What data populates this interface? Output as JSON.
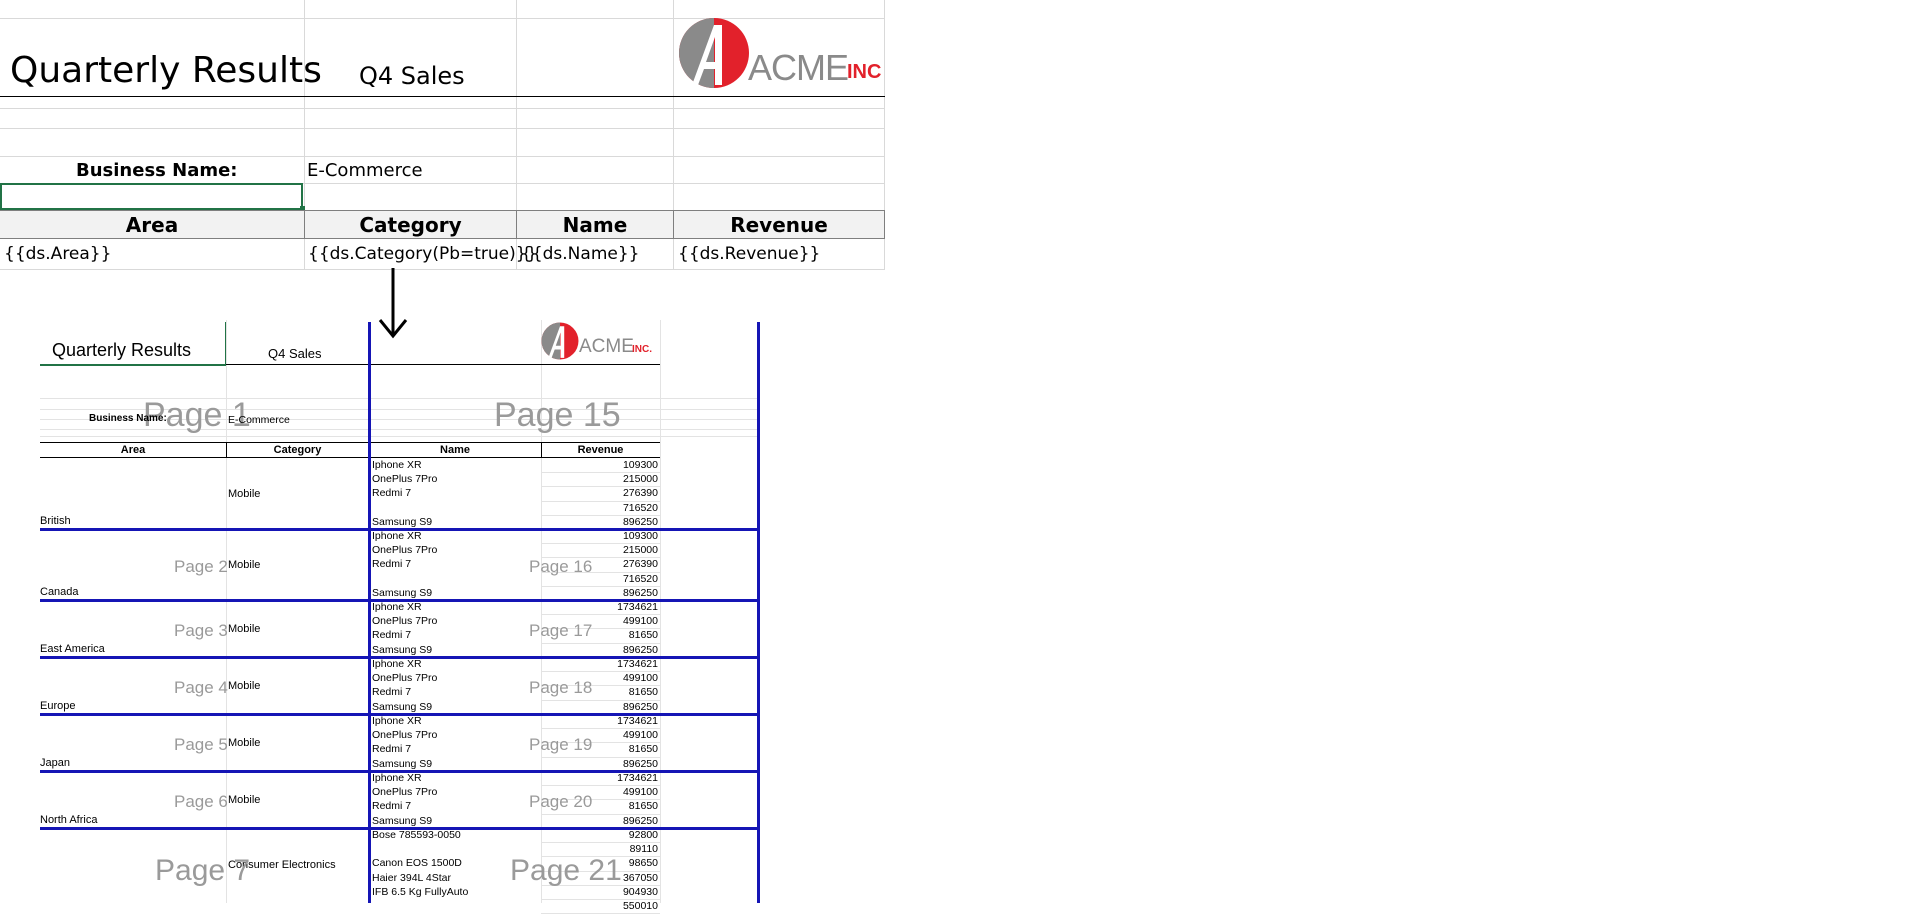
{
  "template": {
    "title": "Quarterly Results",
    "subtitle": "Q4 Sales",
    "business_label": "Business Name:",
    "business_value": "E-Commerce",
    "headers": [
      "Area",
      "Category",
      "Name",
      "Revenue"
    ],
    "placeholders": [
      "{{ds.Area}}",
      "{{ds.Category(Pb=true)}}",
      "{{ds.Name}}",
      "{{ds.Revenue}}"
    ],
    "logo": {
      "acme": "ACME",
      "inc": "INC",
      "mark": "A"
    }
  },
  "preview": {
    "title": "Quarterly Results",
    "subtitle": "Q4 Sales",
    "business_label": "Business Name:",
    "business_value": "E-Commerce",
    "headers": [
      "Area",
      "Category",
      "Name",
      "Revenue"
    ],
    "logo": {
      "acme": "ACME",
      "inc": "INC.",
      "mark": "A"
    },
    "page_labels_large": [
      "Page 1",
      "Page 15",
      "Page 7",
      "Page 21"
    ],
    "groups": [
      {
        "area": "British",
        "category": "Mobile",
        "page_left": "Page 1",
        "page_right": "",
        "names": [
          "Iphone XR",
          "OnePlus 7Pro",
          "Redmi 7",
          "",
          "Samsung S9"
        ],
        "revenues": [
          "109300",
          "215000",
          "276390",
          "716520",
          "896250"
        ]
      },
      {
        "area": "Canada",
        "category": "Mobile",
        "page_left": "Page 2",
        "page_right": "Page 16",
        "names": [
          "Iphone XR",
          "OnePlus 7Pro",
          "Redmi 7",
          "",
          "Samsung S9"
        ],
        "revenues": [
          "109300",
          "215000",
          "276390",
          "716520",
          "896250"
        ]
      },
      {
        "area": "East America",
        "category": "Mobile",
        "page_left": "Page 3",
        "page_right": "Page 17",
        "names": [
          "Iphone XR",
          "OnePlus 7Pro",
          "Redmi 7",
          "Samsung S9"
        ],
        "revenues": [
          "1734621",
          "499100",
          "81650",
          "896250"
        ]
      },
      {
        "area": "Europe",
        "category": "Mobile",
        "page_left": "Page 4",
        "page_right": "Page 18",
        "names": [
          "Iphone XR",
          "OnePlus 7Pro",
          "Redmi 7",
          "Samsung S9"
        ],
        "revenues": [
          "1734621",
          "499100",
          "81650",
          "896250"
        ]
      },
      {
        "area": "Japan",
        "category": "Mobile",
        "page_left": "Page 5",
        "page_right": "Page 19",
        "names": [
          "Iphone XR",
          "OnePlus 7Pro",
          "Redmi 7",
          "Samsung S9"
        ],
        "revenues": [
          "1734621",
          "499100",
          "81650",
          "896250"
        ]
      },
      {
        "area": "North Africa",
        "category": "Mobile",
        "page_left": "Page 6",
        "page_right": "Page 20",
        "names": [
          "Iphone XR",
          "OnePlus 7Pro",
          "Redmi 7",
          "Samsung S9"
        ],
        "revenues": [
          "1734621",
          "499100",
          "81650",
          "896250"
        ]
      },
      {
        "area": "",
        "category": "Consumer Electronics",
        "page_left": "Page 7",
        "page_right": "Page 21",
        "names": [
          "Bose 785593-0050",
          "",
          "Canon EOS 1500D",
          "Haier 394L 4Star",
          "IFB 6.5 Kg FullyAuto",
          ""
        ],
        "revenues": [
          "92800",
          "89110",
          "98650",
          "367050",
          "904930",
          "550010"
        ]
      }
    ]
  },
  "colors": {
    "accent_blue": "#1515b5",
    "logo_red": "#e2212b",
    "logo_grey": "#8a8a8a",
    "header_fill": "#f2f2f2"
  }
}
